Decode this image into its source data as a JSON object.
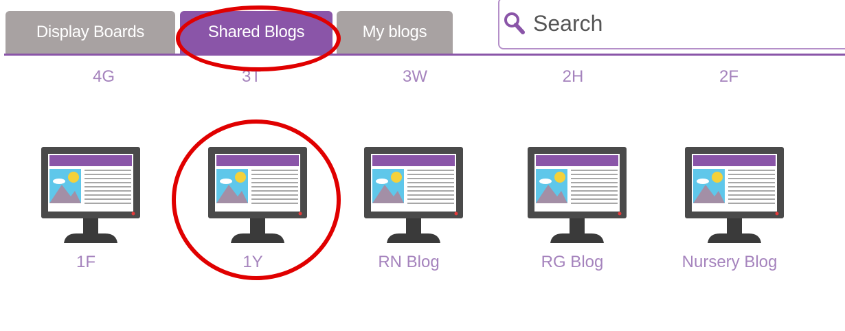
{
  "tabs": [
    {
      "label": "Display Boards",
      "active": false
    },
    {
      "label": "Shared Blogs",
      "active": true
    },
    {
      "label": "My blogs",
      "active": false
    }
  ],
  "search": {
    "placeholder": "Search",
    "value": ""
  },
  "colors": {
    "accent": "#8a55a8",
    "tab_inactive": "#a8a2a2",
    "label_text": "#a583bd",
    "highlight": "#e00000"
  },
  "top_row_blogs": [
    "4G",
    "3T",
    "3W",
    "2H",
    "2F"
  ],
  "blogs": [
    {
      "label": "1F",
      "icon": "monitor-blog-icon"
    },
    {
      "label": "1Y",
      "icon": "monitor-blog-icon"
    },
    {
      "label": "RN Blog",
      "icon": "monitor-blog-icon"
    },
    {
      "label": "RG Blog",
      "icon": "monitor-blog-icon"
    },
    {
      "label": "Nursery Blog",
      "icon": "monitor-blog-icon"
    }
  ]
}
